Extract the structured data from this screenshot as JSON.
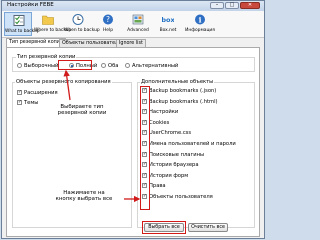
{
  "window": {
    "title": "Настройки FEBE",
    "controls": [
      "–",
      "□",
      "✕"
    ]
  },
  "toolbar": [
    {
      "label": "What to backup",
      "icon": "checklist-icon",
      "active": true
    },
    {
      "label": "Where to backup",
      "icon": "folder-icon"
    },
    {
      "label": "When to backup",
      "icon": "clock-icon"
    },
    {
      "label": "Help",
      "icon": "help-icon"
    },
    {
      "label": "Advanced",
      "icon": "advanced-icon"
    },
    {
      "label": "Box.net",
      "icon": "box-icon"
    },
    {
      "label": "Информация",
      "icon": "info-icon"
    }
  ],
  "tabs": [
    "Тип резервной копии",
    "Объекты пользователя",
    "Ignore list"
  ],
  "backup_type": {
    "legend": "Тип резервной копии",
    "options": [
      "Выборочный",
      "Полный",
      "Оба",
      "Альтернативный"
    ],
    "selected": "Полный"
  },
  "left_group": {
    "legend": "Объекты резервного копирования",
    "items": [
      "Расширения",
      "Темы"
    ]
  },
  "right_group": {
    "legend": "Дополнительные объекты",
    "items": [
      "Backup bookmarks (.json)",
      "Backup bookmarks (.html)",
      "Настройки",
      "Cookies",
      "UserChrome.css",
      "Имена пользователей и пароли",
      "Поисковые плагины",
      "История браузера",
      "История форм",
      "Права",
      "Объекты пользователя"
    ]
  },
  "notes": {
    "type_hint": "Выбираете тип\nрезервной копии",
    "select_hint": "Нажимаете на\nкнопку выбрать все"
  },
  "buttons": {
    "select_all": "Выбрать все",
    "clear_all": "Очистить все"
  },
  "colors": {
    "accent_red": "#d11a1a",
    "selected_tab": "#cfe3f8"
  }
}
